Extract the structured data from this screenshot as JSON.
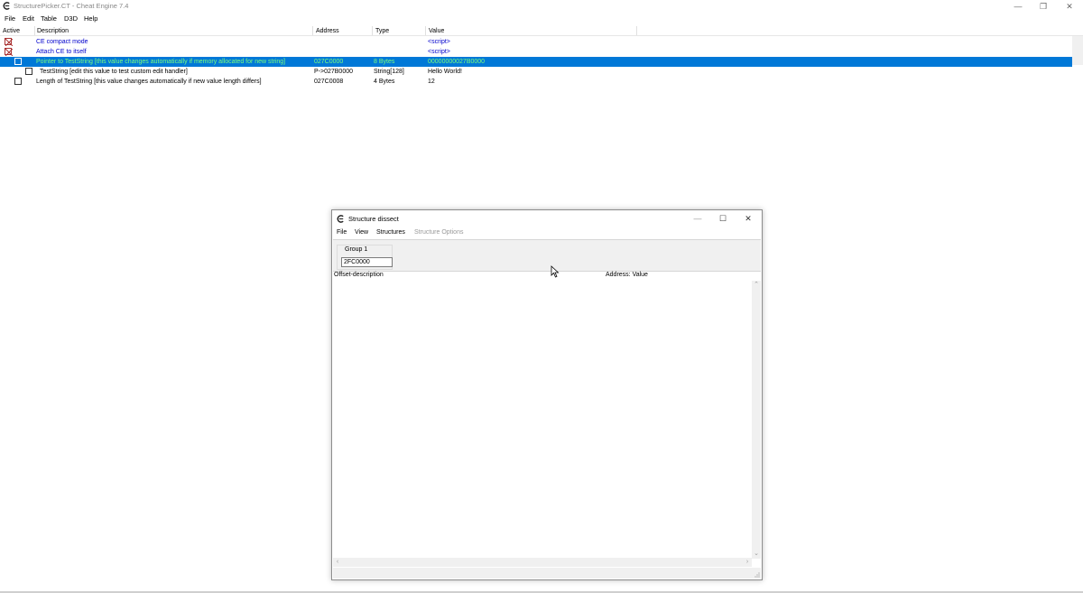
{
  "window": {
    "title": "StructurePicker.CT - Cheat Engine 7.4",
    "controls": [
      "—",
      "❐",
      "✕"
    ]
  },
  "menu": [
    "File",
    "Edit",
    "Table",
    "D3D",
    "Help"
  ],
  "table": {
    "headers": [
      "Active",
      "Description",
      "Address",
      "Type",
      "Value"
    ],
    "rows": [
      {
        "description": "CE compact mode",
        "address": "",
        "type": "",
        "value": "<script>"
      },
      {
        "description": "Attach CE to itself",
        "address": "",
        "type": "",
        "value": "<script>"
      },
      {
        "description": "Pointer to TestString [this value changes automatically if memory allocated for new string]",
        "address": "027C0000",
        "type": "8 Bytes",
        "value": "00000000027B0000"
      },
      {
        "description": "TestString [edit this value to test custom edit handler]",
        "address": "P->027B0000",
        "type": "String[128]",
        "value": "Hello World!"
      },
      {
        "description": "Length of TestString [this value changes automatically if new value length differs]",
        "address": "027C0008",
        "type": "4 Bytes",
        "value": "12"
      }
    ]
  },
  "dialog": {
    "title": "Structure dissect",
    "controls": [
      "—",
      "☐",
      "✕"
    ],
    "menu": [
      "File",
      "View",
      "Structures",
      "Structure Options"
    ],
    "group_label": "Group 1",
    "address_value": "2FC0000",
    "columns": [
      "Offset-description",
      "Address: Value"
    ]
  }
}
